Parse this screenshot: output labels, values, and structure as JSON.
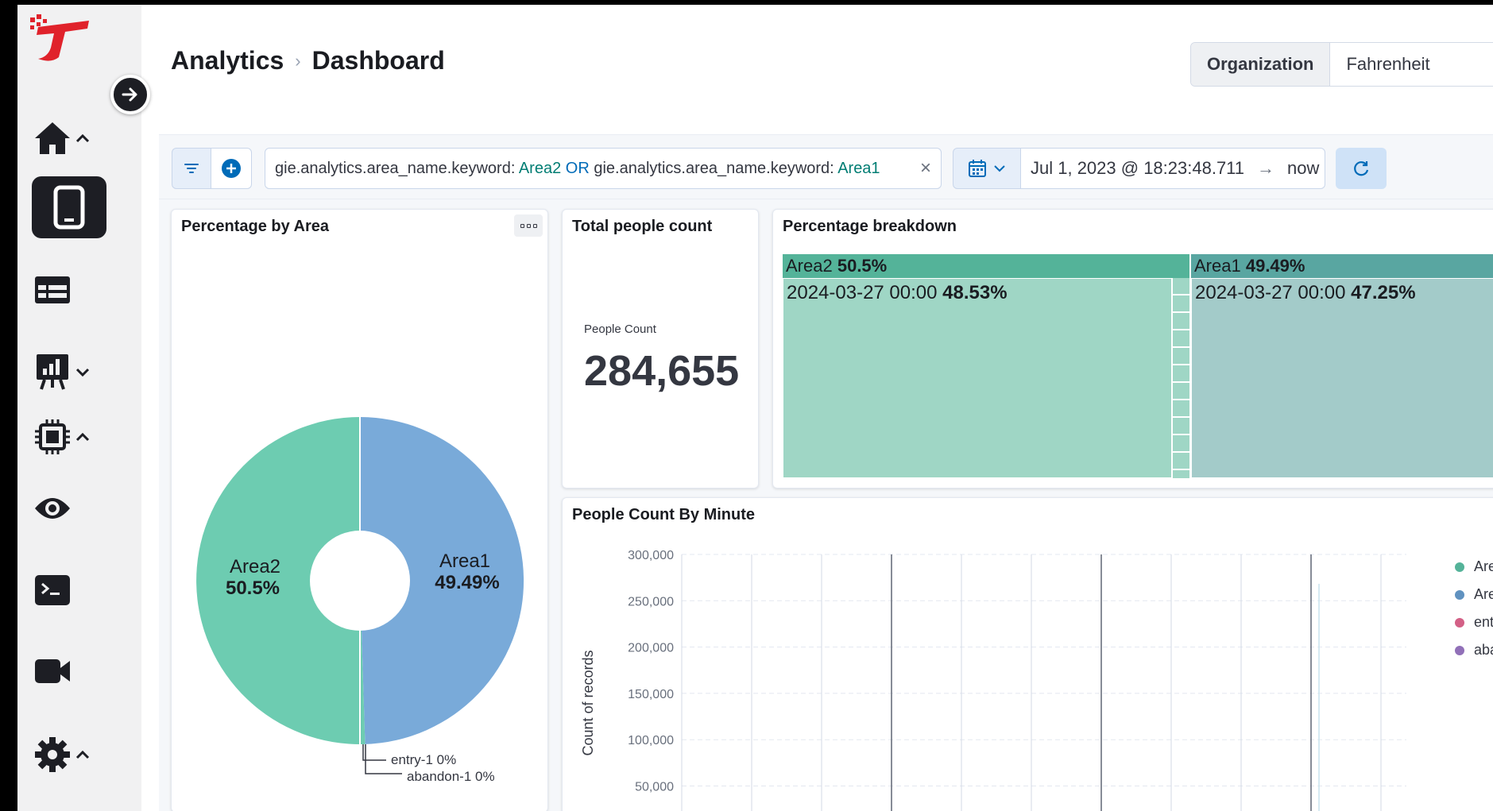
{
  "breadcrumb": {
    "parent": "Analytics",
    "separator": "›",
    "current": "Dashboard"
  },
  "organization": {
    "label": "Organization",
    "value": "Fahrenheit"
  },
  "query": {
    "field1": "gie.analytics.area_name.keyword:",
    "value1": "Area2",
    "operator": "OR",
    "field2": "gie.analytics.area_name.keyword:",
    "value2": "Area1",
    "clear": "×"
  },
  "date": {
    "start": "Jul 1, 2023 @ 18:23:48.711",
    "arrow": "→",
    "end": "now"
  },
  "panels": {
    "pie": {
      "title": "Percentage by Area"
    },
    "total": {
      "title": "Total people count",
      "label": "People Count",
      "value": "284,655"
    },
    "treemap": {
      "title": "Percentage breakdown"
    },
    "line": {
      "title": "People Count By Minute"
    }
  },
  "colors": {
    "area2": "#6dccb1",
    "area1": "#79aad9",
    "entry": "#e7664c",
    "abandon": "#9170b8",
    "tm_area2_header": "#54b399",
    "tm_area2_body": "#9fd6c5",
    "tm_area1_header": "#59a6a1",
    "tm_area1_body": "#a3cbc9"
  },
  "chart_data": [
    {
      "type": "pie",
      "donut": true,
      "slices": [
        {
          "name": "Area2",
          "label": "Area2",
          "pct_label": "50.5%",
          "value": 50.5
        },
        {
          "name": "Area1",
          "label": "Area1",
          "pct_label": "49.49%",
          "value": 49.49
        },
        {
          "name": "entry-1",
          "label": "entry-1  0%",
          "value": 0
        },
        {
          "name": "abandon-1",
          "label": "abandon-1  0%",
          "value": 0
        }
      ]
    },
    {
      "type": "treemap",
      "groups": [
        {
          "name": "Area2",
          "pct": "50.5%",
          "value": 50.5,
          "child_label": "2024-03-27 00:00",
          "child_pct": "48.53%"
        },
        {
          "name": "Area1",
          "pct": "49.49%",
          "value": 49.49,
          "child_label": "2024-03-27 00:00",
          "child_pct": "47.25%"
        }
      ]
    },
    {
      "type": "line",
      "ylabel": "Count of records",
      "yticks": [
        "300,000",
        "250,000",
        "200,000",
        "150,000",
        "100,000",
        "50,000"
      ],
      "ytick_values": [
        300000,
        250000,
        200000,
        150000,
        100000,
        50000
      ],
      "grid": true,
      "legend_position": "right",
      "legend": [
        "Area",
        "Area",
        "entr",
        "aba"
      ]
    }
  ]
}
